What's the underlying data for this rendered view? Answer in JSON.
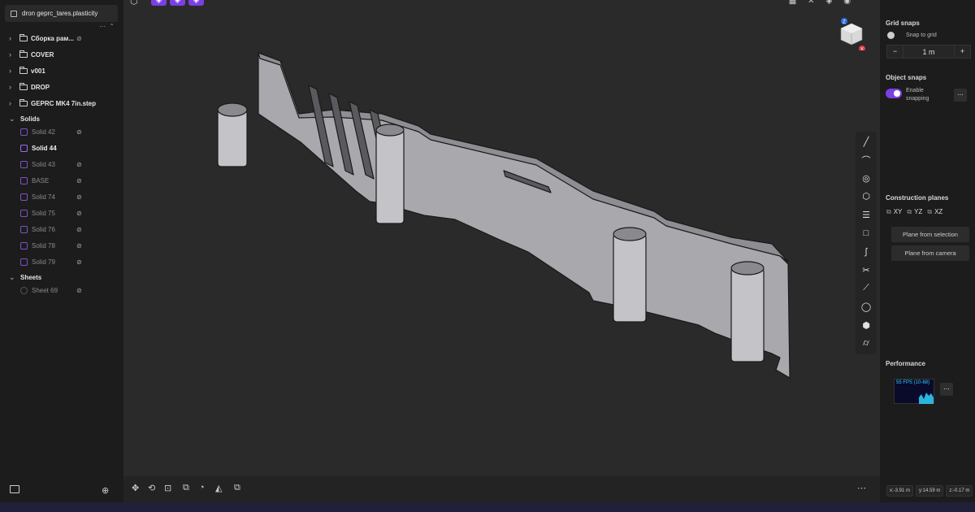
{
  "file": {
    "name": "dron geprc_tares.plasticity",
    "icon": "file-icon"
  },
  "tree_tools": "⋯ ⌃",
  "tree": {
    "folders": [
      {
        "label": "Сборка рам...",
        "eye": "⊘"
      },
      {
        "label": "COVER",
        "eye": ""
      },
      {
        "label": "v001",
        "eye": ""
      },
      {
        "label": "DROP",
        "eye": ""
      },
      {
        "label": "GEPRC MK4 7in.step",
        "eye": ""
      }
    ],
    "solids_section": "Solids",
    "solids": [
      {
        "label": "Solid 42",
        "eye": "⊘"
      },
      {
        "label": "Solid 44",
        "eye": "",
        "active": true
      },
      {
        "label": "Solid 43",
        "eye": "⊘"
      },
      {
        "label": "BASE",
        "eye": "⊘"
      },
      {
        "label": "Solid 74",
        "eye": "⊘"
      },
      {
        "label": "Solid 75",
        "eye": "⊘"
      },
      {
        "label": "Solid 76",
        "eye": "⊘"
      },
      {
        "label": "Solid 78",
        "eye": "⊘"
      },
      {
        "label": "Solid 79",
        "eye": "⊘"
      }
    ],
    "sheets_section": "Sheets",
    "sheets": [
      {
        "label": "Sheet 69",
        "eye": "⊘"
      }
    ]
  },
  "viewport": {
    "navcube": {
      "z": "Z",
      "x": "X"
    },
    "toolbar_icons": [
      "line-icon",
      "curve-icon",
      "circle-icon",
      "polygon-icon",
      "cylinder-stack-icon",
      "rectangle-icon",
      "spline-icon",
      "scissors-icon",
      "trim-icon",
      "sphere-icon",
      "box-icon",
      "cylinder-icon"
    ],
    "bottom_more": "⋯"
  },
  "right_panel": {
    "grid_snaps_title": "Grid snaps",
    "snap_to_grid": "Snap to grid",
    "grid_minus": "−",
    "grid_value": "1 m",
    "grid_plus": "+",
    "object_snaps_title": "Object snaps",
    "enable_snapping": "Enable snapping",
    "more": "...",
    "construction_planes_title": "Construction planes",
    "planes": [
      "XY",
      "YZ",
      "XZ"
    ],
    "plane_from_selection": "Plane from selection",
    "plane_from_camera": "Plane from camera",
    "performance_title": "Performance",
    "fps": "55 FPS (10-68)",
    "coords": [
      "x:-3.91 m",
      "y:14.59 m",
      "z:-0.17 m"
    ]
  },
  "colors": {
    "accent": "#7b3fe4",
    "fps_text": "#2fd3ff",
    "model": "#a9a9ad"
  }
}
